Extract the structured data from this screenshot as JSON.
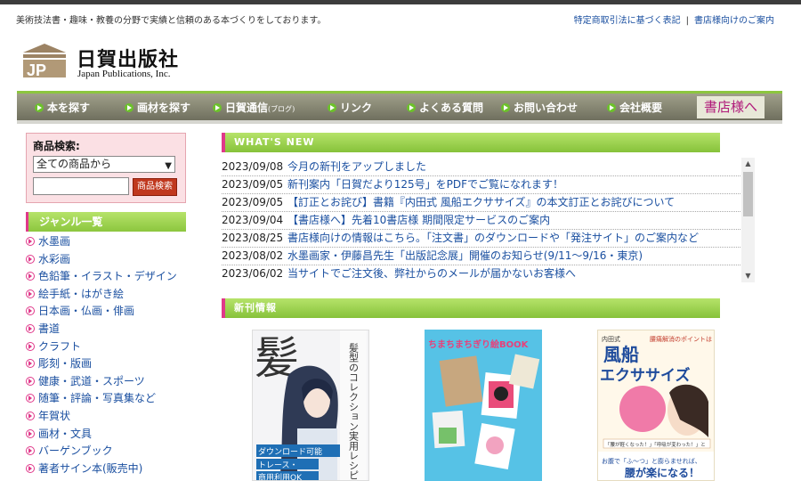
{
  "header": {
    "tagline": "美術技法書・趣味・教養の分野で実績と信頼のある本づくりをしております。",
    "links": [
      "特定商取引法に基づく表記",
      "書店様向けのご案内"
    ],
    "separator": "|"
  },
  "logo": {
    "title": "日賀出版社",
    "subtitle": "Japan Publications, Inc.",
    "mark_letters": "JP"
  },
  "nav": {
    "items": [
      {
        "label": "本を探す"
      },
      {
        "label": "画材を探す"
      },
      {
        "label": "日賀通信",
        "suffix": "(ブログ)"
      },
      {
        "label": "リンク"
      },
      {
        "label": "よくある質問"
      },
      {
        "label": "お問い合わせ"
      },
      {
        "label": "会社概要"
      }
    ],
    "shop_button": "書店様へ"
  },
  "search": {
    "label": "商品検索:",
    "selected": "全ての商品から",
    "input_value": "",
    "button": "商品検索"
  },
  "genre": {
    "title": "ジャンル一覧",
    "items": [
      "水墨画",
      "水彩画",
      "色鉛筆・イラスト・デザイン",
      "絵手紙・はがき絵",
      "日本画・仏画・俳画",
      "書道",
      "クラフト",
      "彫刻・版画",
      "健康・武道・スポーツ",
      "随筆・評論・写真集など",
      "年賀状",
      "画材・文具",
      "バーゲンブック",
      "著者サイン本(販売中)"
    ]
  },
  "whats_new": {
    "title": "WHAT'S NEW",
    "items": [
      {
        "date": "2023/09/08",
        "title": "今月の新刊をアップしました"
      },
      {
        "date": "2023/09/05",
        "title": "新刊案内「日賀だより125号」をPDFでご覧になれます！"
      },
      {
        "date": "2023/09/05",
        "title": "【訂正とお詫び】書籍『内田式 風船エクササイズ』の本文訂正とお詫びについて"
      },
      {
        "date": "2023/09/04",
        "title": "【書店様へ】先着10書店様 期間限定サービスのご案内"
      },
      {
        "date": "2023/08/25",
        "title": "書店様向けの情報はこちら。「注文書」のダウンロードや「発注サイト」のご案内など"
      },
      {
        "date": "2023/08/02",
        "title": "水墨画家・伊藤昌先生「出版記念展」開催のお知らせ(9/11～9/16・東京)"
      },
      {
        "date": "2023/06/02",
        "title": "当サイトでご注文後、弊社からのメールが届かないお客様へ"
      }
    ]
  },
  "new_books": {
    "title": "新刊情報",
    "books": [
      {
        "big_char": "髪",
        "side_text": "髪型のコレクション実用レシピ",
        "labels": [
          "ダウンロード可能",
          "トレース・",
          "商用利用OK"
        ]
      },
      {
        "title": "ちまちまちぎり絵BOOK"
      },
      {
        "series": "内田式",
        "title1": "風船",
        "title2": "エクササイズ",
        "tag": "腰痛解消のポイントは「舌圧」と「腹圧」",
        "quote": "「腰が軽くなった！」「呼吸が変わった！」と",
        "bottom1": "お腹で「ふ～つ」と膨らませれば、",
        "bottom2": "腰が楽になる！"
      }
    ]
  },
  "colors": {
    "accent_green": "#8cc63e",
    "accent_pink": "#e0388a",
    "link_blue": "#1a4fa0",
    "nav_bg": "#7f7f6c"
  }
}
